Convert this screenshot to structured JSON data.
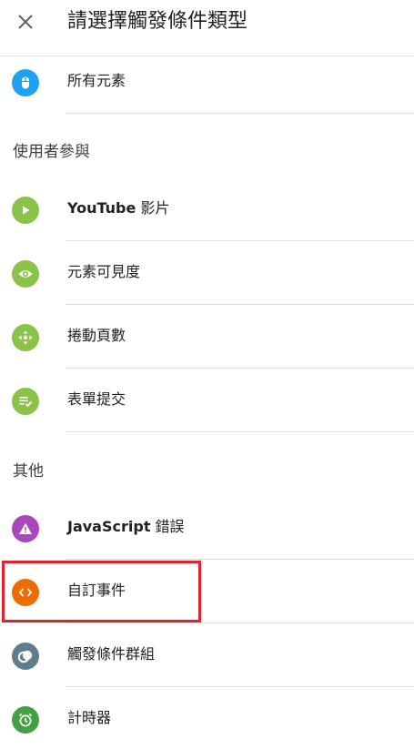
{
  "header": {
    "title": "請選擇觸發條件類型"
  },
  "top_items": [
    {
      "label": "所有元素",
      "icon": "mouse-icon",
      "color": "#1da1f2"
    }
  ],
  "sections": [
    {
      "label": "使用者參與",
      "items": [
        {
          "bold": "YouTube",
          "label": " 影片",
          "icon": "play-icon",
          "color": "#8bc34a"
        },
        {
          "label": "元素可見度",
          "icon": "eye-icon",
          "color": "#8bc34a"
        },
        {
          "label": "捲動頁數",
          "icon": "scroll-icon",
          "color": "#8bc34a"
        },
        {
          "label": "表單提交",
          "icon": "form-check-icon",
          "color": "#8bc34a"
        }
      ]
    },
    {
      "label": "其他",
      "items": [
        {
          "bold": "JavaScript",
          "label": " 錯誤",
          "icon": "warning-icon",
          "color": "#ab47bc"
        },
        {
          "label": "自訂事件",
          "icon": "code-icon",
          "color": "#ef6c00"
        },
        {
          "label": "觸發條件群組",
          "icon": "group-icon",
          "color": "#607d8b"
        },
        {
          "label": "計時器",
          "icon": "alarm-icon",
          "color": "#43a047"
        }
      ]
    }
  ]
}
